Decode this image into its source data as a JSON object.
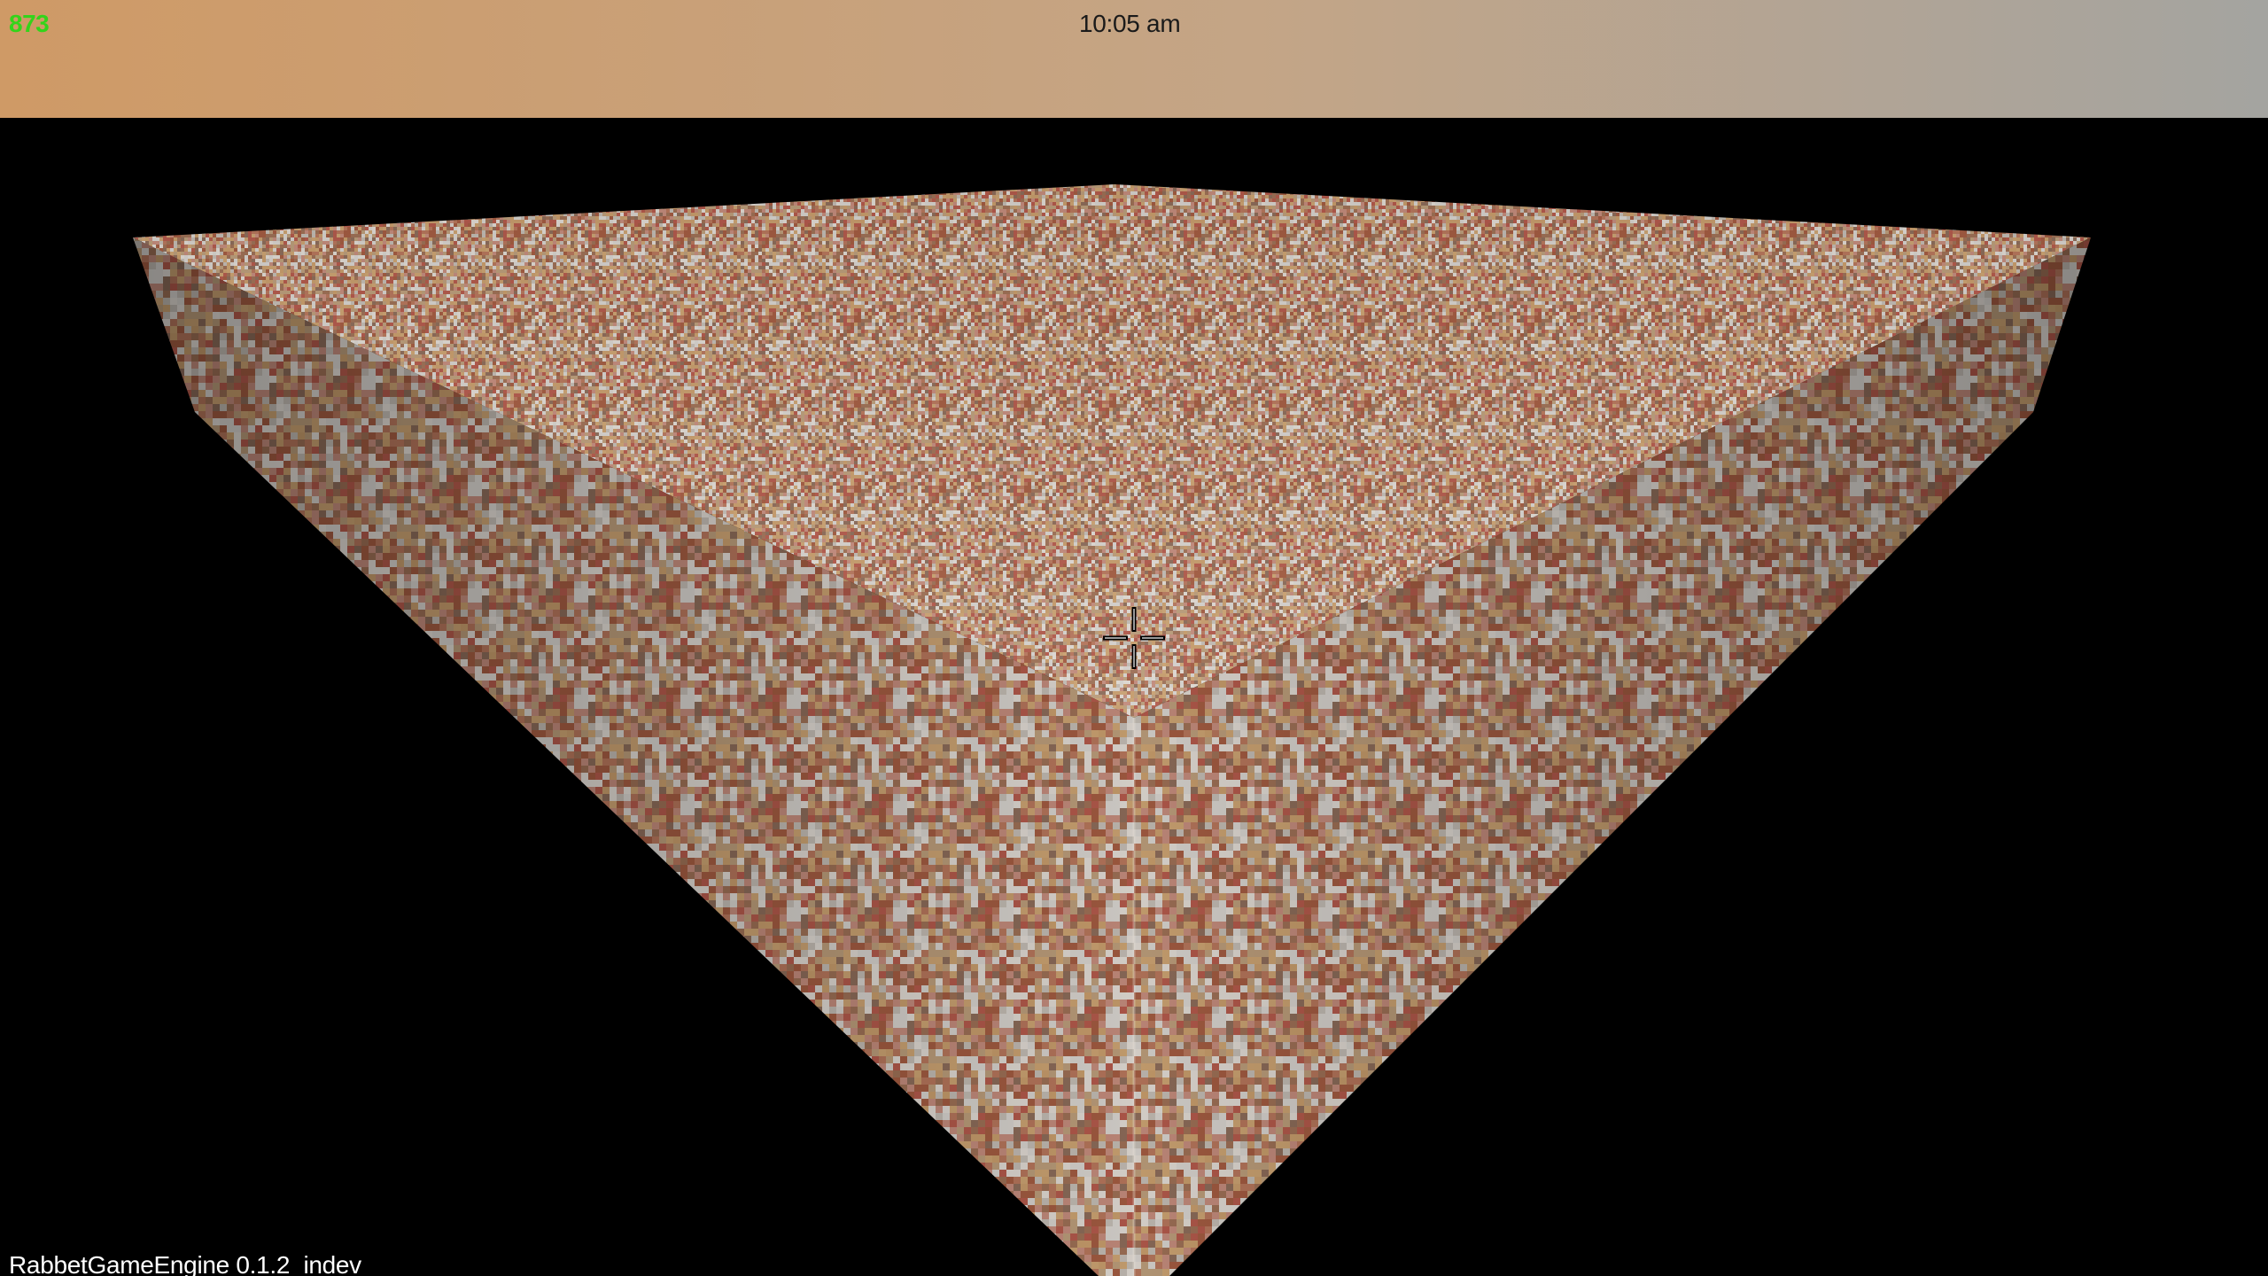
{
  "hud": {
    "fps": "873",
    "clock": "10:05 am",
    "version": "RabbetGameEngine 0.1.2_indev"
  },
  "colors": {
    "fps_text": "#33d41a",
    "sky_left": "#cf9a66",
    "sky_mid": "#c4a586",
    "sky_right": "#a4a4a0",
    "void": "#000000",
    "terrain_base": "#a8866a",
    "terrain_palette": [
      "#b3745a",
      "#c0897a",
      "#9b6e54",
      "#b89a78",
      "#d3cfca",
      "#bfb8b0",
      "#c8a070",
      "#a05a40",
      "#8a6a58",
      "#dcd6cf",
      "#b0584a",
      "#c49a6a"
    ]
  },
  "icons": {
    "crosshair": "crosshair-icon"
  }
}
